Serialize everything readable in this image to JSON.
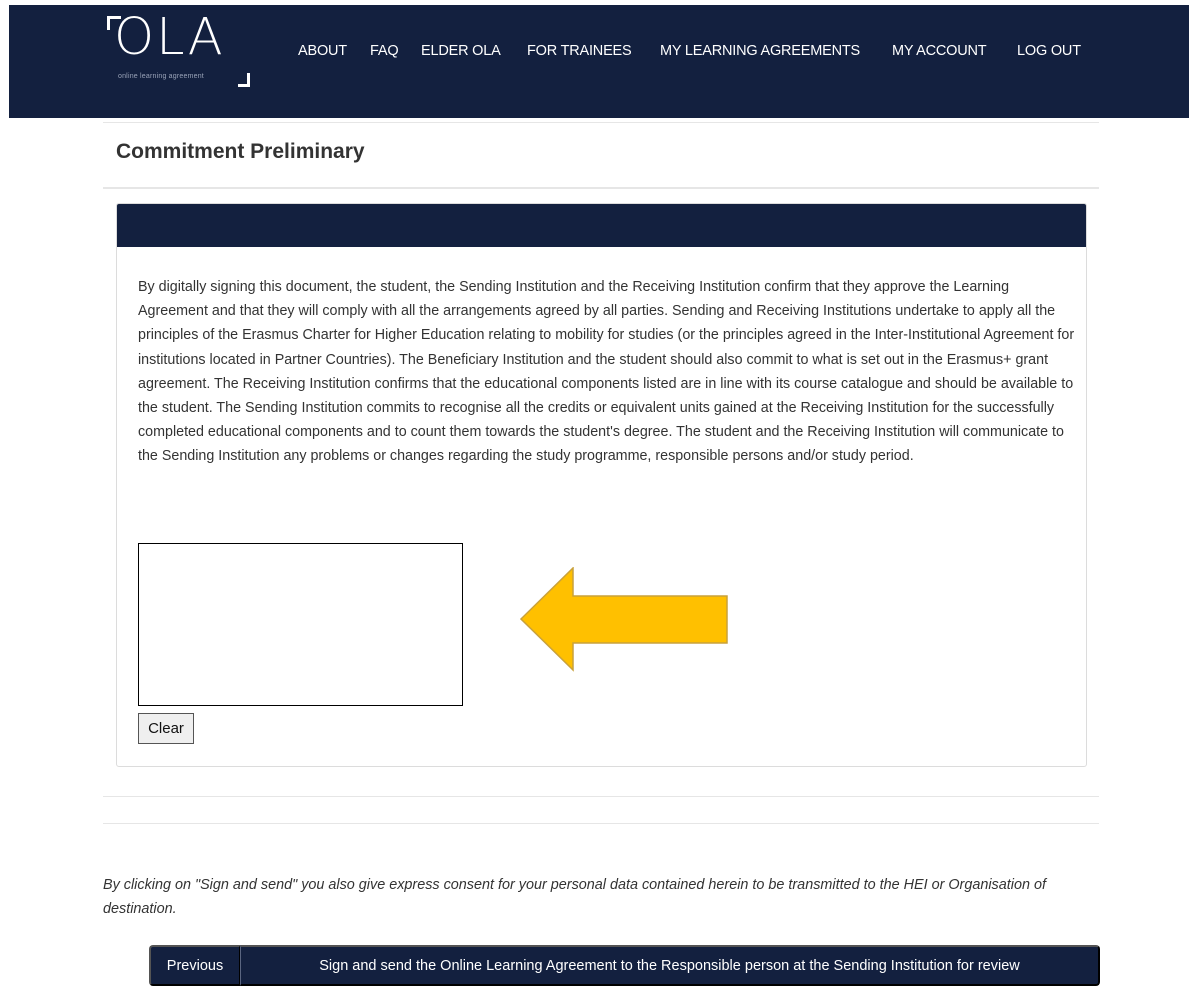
{
  "header": {
    "logo_text": "OLA",
    "logo_tagline": "online learning agreement",
    "nav": [
      {
        "label": "ABOUT"
      },
      {
        "label": "FAQ"
      },
      {
        "label": "ELDER OLA"
      },
      {
        "label": "FOR TRAINEES"
      },
      {
        "label": "MY LEARNING AGREEMENTS"
      },
      {
        "label": "MY ACCOUNT"
      },
      {
        "label": "LOG OUT"
      }
    ]
  },
  "page": {
    "title": "Commitment Preliminary"
  },
  "commitment": {
    "text": "By digitally signing this document, the student, the Sending Institution and the Receiving Institution confirm that they approve the Learning Agreement and that they will comply with all the arrangements agreed by all parties. Sending and Receiving Institutions undertake to apply all the principles of the Erasmus Charter for Higher Education relating to mobility for studies (or the principles agreed in the Inter-Institutional Agreement for institutions located in Partner Countries). The Beneficiary Institution and the student should also commit to what is set out in the Erasmus+ grant agreement. The Receiving Institution confirms that the educational components listed are in line with its course catalogue and should be available to the student. The Sending Institution commits to recognise all the credits or equivalent units gained at the Receiving Institution for the successfully completed educational components and to count them towards the student's degree. The student and the Receiving Institution will communicate to the Sending Institution any problems or changes regarding the study programme, responsible persons and/or study period.",
    "clear_label": "Clear"
  },
  "consent": {
    "text": "By clicking on \"Sign and send\" you also give express consent for your personal data contained herein to be transmitted to the HEI or Organisation of destination."
  },
  "actions": {
    "previous_label": "Previous",
    "sign_label": "Sign and send the Online Learning Agreement to the Responsible person at the Sending Institution for review"
  },
  "colors": {
    "navy": "#13203f",
    "arrow_fill": "#ffc000",
    "arrow_stroke": "#c9a13a"
  }
}
